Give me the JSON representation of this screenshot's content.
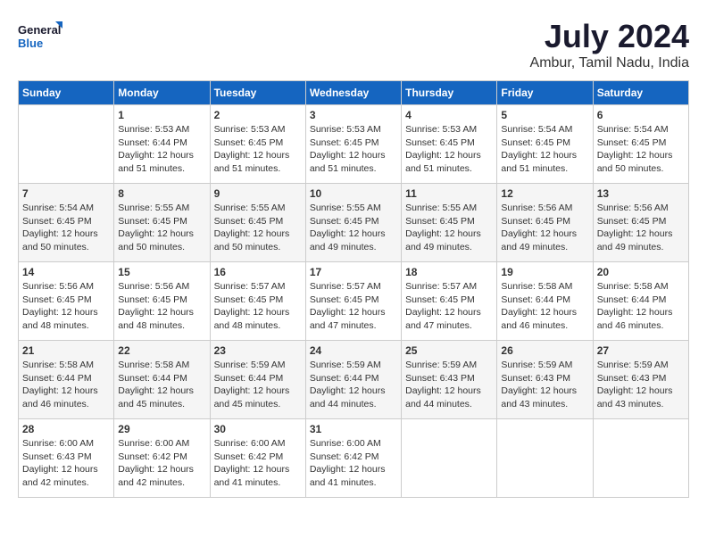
{
  "logo": {
    "line1": "General",
    "line2": "Blue"
  },
  "title": "July 2024",
  "location": "Ambur, Tamil Nadu, India",
  "header_days": [
    "Sunday",
    "Monday",
    "Tuesday",
    "Wednesday",
    "Thursday",
    "Friday",
    "Saturday"
  ],
  "weeks": [
    [
      {
        "day": "",
        "text": ""
      },
      {
        "day": "1",
        "text": "Sunrise: 5:53 AM\nSunset: 6:44 PM\nDaylight: 12 hours\nand 51 minutes."
      },
      {
        "day": "2",
        "text": "Sunrise: 5:53 AM\nSunset: 6:45 PM\nDaylight: 12 hours\nand 51 minutes."
      },
      {
        "day": "3",
        "text": "Sunrise: 5:53 AM\nSunset: 6:45 PM\nDaylight: 12 hours\nand 51 minutes."
      },
      {
        "day": "4",
        "text": "Sunrise: 5:53 AM\nSunset: 6:45 PM\nDaylight: 12 hours\nand 51 minutes."
      },
      {
        "day": "5",
        "text": "Sunrise: 5:54 AM\nSunset: 6:45 PM\nDaylight: 12 hours\nand 51 minutes."
      },
      {
        "day": "6",
        "text": "Sunrise: 5:54 AM\nSunset: 6:45 PM\nDaylight: 12 hours\nand 50 minutes."
      }
    ],
    [
      {
        "day": "7",
        "text": "Sunrise: 5:54 AM\nSunset: 6:45 PM\nDaylight: 12 hours\nand 50 minutes."
      },
      {
        "day": "8",
        "text": "Sunrise: 5:55 AM\nSunset: 6:45 PM\nDaylight: 12 hours\nand 50 minutes."
      },
      {
        "day": "9",
        "text": "Sunrise: 5:55 AM\nSunset: 6:45 PM\nDaylight: 12 hours\nand 50 minutes."
      },
      {
        "day": "10",
        "text": "Sunrise: 5:55 AM\nSunset: 6:45 PM\nDaylight: 12 hours\nand 49 minutes."
      },
      {
        "day": "11",
        "text": "Sunrise: 5:55 AM\nSunset: 6:45 PM\nDaylight: 12 hours\nand 49 minutes."
      },
      {
        "day": "12",
        "text": "Sunrise: 5:56 AM\nSunset: 6:45 PM\nDaylight: 12 hours\nand 49 minutes."
      },
      {
        "day": "13",
        "text": "Sunrise: 5:56 AM\nSunset: 6:45 PM\nDaylight: 12 hours\nand 49 minutes."
      }
    ],
    [
      {
        "day": "14",
        "text": "Sunrise: 5:56 AM\nSunset: 6:45 PM\nDaylight: 12 hours\nand 48 minutes."
      },
      {
        "day": "15",
        "text": "Sunrise: 5:56 AM\nSunset: 6:45 PM\nDaylight: 12 hours\nand 48 minutes."
      },
      {
        "day": "16",
        "text": "Sunrise: 5:57 AM\nSunset: 6:45 PM\nDaylight: 12 hours\nand 48 minutes."
      },
      {
        "day": "17",
        "text": "Sunrise: 5:57 AM\nSunset: 6:45 PM\nDaylight: 12 hours\nand 47 minutes."
      },
      {
        "day": "18",
        "text": "Sunrise: 5:57 AM\nSunset: 6:45 PM\nDaylight: 12 hours\nand 47 minutes."
      },
      {
        "day": "19",
        "text": "Sunrise: 5:58 AM\nSunset: 6:44 PM\nDaylight: 12 hours\nand 46 minutes."
      },
      {
        "day": "20",
        "text": "Sunrise: 5:58 AM\nSunset: 6:44 PM\nDaylight: 12 hours\nand 46 minutes."
      }
    ],
    [
      {
        "day": "21",
        "text": "Sunrise: 5:58 AM\nSunset: 6:44 PM\nDaylight: 12 hours\nand 46 minutes."
      },
      {
        "day": "22",
        "text": "Sunrise: 5:58 AM\nSunset: 6:44 PM\nDaylight: 12 hours\nand 45 minutes."
      },
      {
        "day": "23",
        "text": "Sunrise: 5:59 AM\nSunset: 6:44 PM\nDaylight: 12 hours\nand 45 minutes."
      },
      {
        "day": "24",
        "text": "Sunrise: 5:59 AM\nSunset: 6:44 PM\nDaylight: 12 hours\nand 44 minutes."
      },
      {
        "day": "25",
        "text": "Sunrise: 5:59 AM\nSunset: 6:43 PM\nDaylight: 12 hours\nand 44 minutes."
      },
      {
        "day": "26",
        "text": "Sunrise: 5:59 AM\nSunset: 6:43 PM\nDaylight: 12 hours\nand 43 minutes."
      },
      {
        "day": "27",
        "text": "Sunrise: 5:59 AM\nSunset: 6:43 PM\nDaylight: 12 hours\nand 43 minutes."
      }
    ],
    [
      {
        "day": "28",
        "text": "Sunrise: 6:00 AM\nSunset: 6:43 PM\nDaylight: 12 hours\nand 42 minutes."
      },
      {
        "day": "29",
        "text": "Sunrise: 6:00 AM\nSunset: 6:42 PM\nDaylight: 12 hours\nand 42 minutes."
      },
      {
        "day": "30",
        "text": "Sunrise: 6:00 AM\nSunset: 6:42 PM\nDaylight: 12 hours\nand 41 minutes."
      },
      {
        "day": "31",
        "text": "Sunrise: 6:00 AM\nSunset: 6:42 PM\nDaylight: 12 hours\nand 41 minutes."
      },
      {
        "day": "",
        "text": ""
      },
      {
        "day": "",
        "text": ""
      },
      {
        "day": "",
        "text": ""
      }
    ]
  ]
}
